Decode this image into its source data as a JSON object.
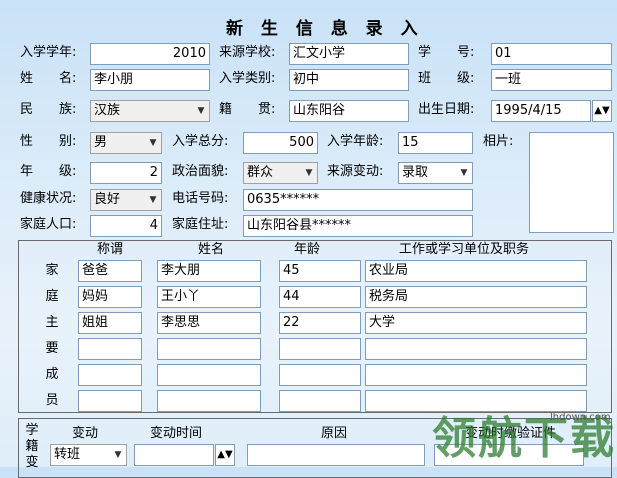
{
  "window_title": "新 生 信 息 录 入",
  "row1": {
    "year_label": "入学学年:",
    "year_value": "2010",
    "school_label": "来源学校:",
    "school_value": "汇文小学",
    "id_label": "学　　号:",
    "id_value": "01"
  },
  "row2": {
    "name_label": "姓　　名:",
    "name_value": "李小朋",
    "type_label": "入学类别:",
    "type_value": "初中",
    "class_label": "班　　级:",
    "class_value": "一班"
  },
  "row3": {
    "nation_label": "民　　族:",
    "nation_value": "汉族",
    "origin_label": "籍　　贯:",
    "origin_value": "山东阳谷",
    "birth_label": "出生日期:",
    "birth_value": "1995/4/15"
  },
  "row4": {
    "gender_label": "性　　别:",
    "gender_value": "男",
    "score_label": "入学总分:",
    "score_value": "500",
    "age_label": "入学年龄:",
    "age_value": "15",
    "photo_label": "相片:"
  },
  "row5": {
    "grade_label": "年　　级:",
    "grade_value": "2",
    "political_label": "政治面貌:",
    "political_value": "群众",
    "change_label": "来源变动:",
    "change_value": "录取"
  },
  "row6": {
    "health_label": "健康状况:",
    "health_value": "良好",
    "phone_label": "电话号码:",
    "phone_value": "0635******"
  },
  "row7": {
    "pop_label": "家庭人口:",
    "pop_value": "4",
    "addr_label": "家庭住址:",
    "addr_value": "山东阳谷县******"
  },
  "family": {
    "side_label": [
      "家",
      "庭",
      "主",
      "要",
      "成",
      "员"
    ],
    "headers": [
      "称谓",
      "姓名",
      "年龄",
      "工作或学习单位及职务"
    ],
    "rows": [
      [
        "爸爸",
        "李大朋",
        "45",
        "农业局"
      ],
      [
        "妈妈",
        "王小丫",
        "44",
        "税务局"
      ],
      [
        "姐姐",
        "李思思",
        "22",
        "大学"
      ],
      [
        "",
        "",
        "",
        ""
      ],
      [
        "",
        "",
        "",
        ""
      ],
      [
        "",
        "",
        "",
        ""
      ]
    ]
  },
  "status": {
    "side_label": [
      "学",
      "籍",
      "变"
    ],
    "headers": [
      "变动",
      "变动时间",
      "原因",
      "变动时缴验证件"
    ],
    "change_value": "转班"
  },
  "watermark": {
    "text": "领航下载",
    "url": "lhdown.com"
  },
  "colors": {
    "input_border": "#7f9db9",
    "background": "#c9e2f7"
  }
}
